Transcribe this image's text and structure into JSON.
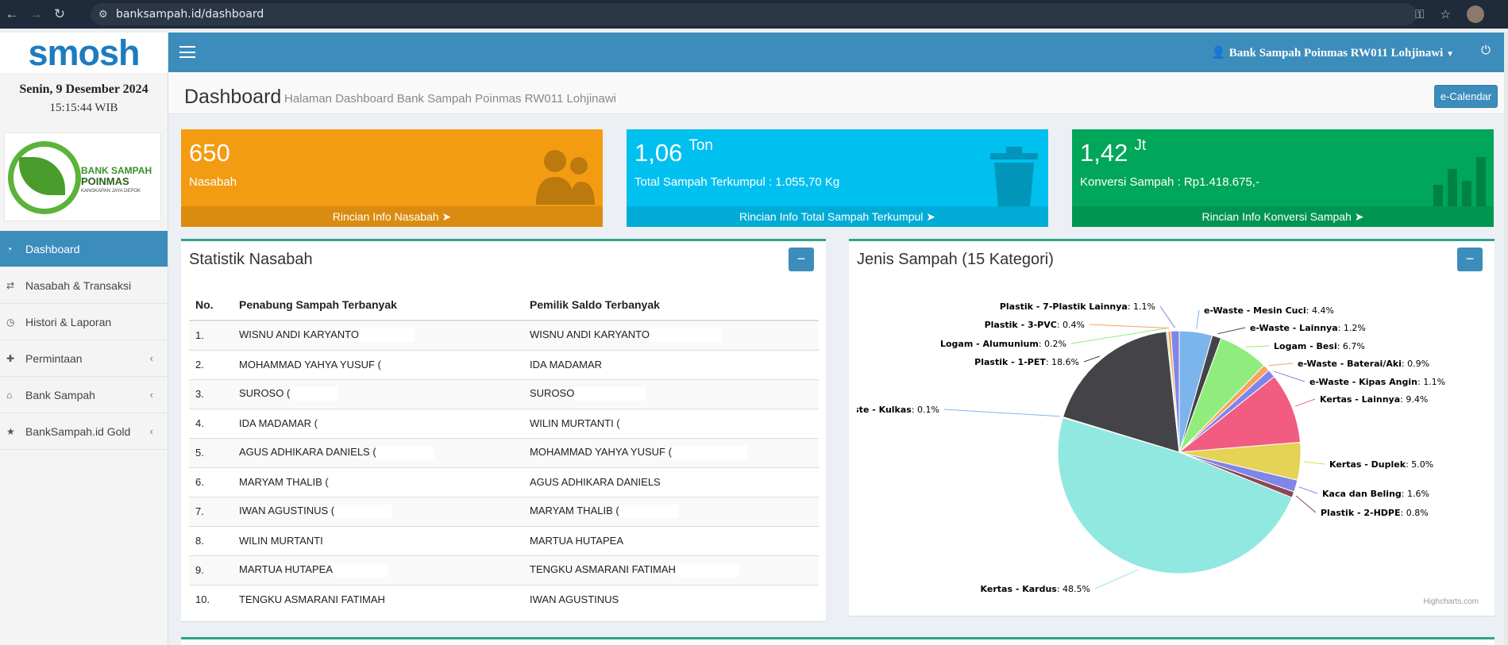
{
  "browser": {
    "url": "banksampah.id/dashboard"
  },
  "app": {
    "logo_text": "smosh",
    "date": "Senin, 9 Desember 2024",
    "time": "15:15:44 WIB"
  },
  "brand_logo": {
    "line1": "BANK SAMPAH",
    "line2": "POINMAS",
    "line3": "KANGKAPAN JAYA DEPOK"
  },
  "sidebar": {
    "items": [
      {
        "label": "Dashboard"
      },
      {
        "label": "Nasabah & Transaksi"
      },
      {
        "label": "Histori & Laporan"
      },
      {
        "label": "Permintaan"
      },
      {
        "label": "Bank Sampah"
      },
      {
        "label": "BankSampah.id Gold"
      }
    ]
  },
  "header": {
    "user": "Bank Sampah Poinmas RW011 Lohjinawi"
  },
  "page": {
    "title": "Dashboard",
    "subtitle": "Halaman Dashboard Bank Sampah Poinmas RW011 Lohjinawi",
    "ecal_label": "e-Calendar"
  },
  "cards": [
    {
      "value": "650",
      "unit": "",
      "label": "Nasabah",
      "link": "Rincian Info Nasabah",
      "color": "#f39c12",
      "foot_color": "#da8c10"
    },
    {
      "value": "1,06",
      "unit": "Ton",
      "label": "Total Sampah Terkumpul : 1.055,70 Kg",
      "link": "Rincian Info Total Sampah Terkumpul",
      "color": "#00c0ef",
      "foot_color": "#00acd6"
    },
    {
      "value": "1,42",
      "unit": "Jt",
      "label": "Konversi Sampah : Rp1.418.675,-",
      "link": "Rincian Info Konversi Sampah",
      "color": "#00a65a",
      "foot_color": "#009551"
    }
  ],
  "stat": {
    "title": "Statistik Nasabah",
    "headers": [
      "No.",
      "Penabung Sampah Terbanyak",
      "Pemilik Saldo Terbanyak"
    ],
    "rows": [
      {
        "no": "1.",
        "penabung": "WISNU ANDI KARYANTO",
        "pemilik": "WISNU ANDI KARYANTO"
      },
      {
        "no": "2.",
        "penabung": "MOHAMMAD YAHYA YUSUF (",
        "pemilik": "IDA MADAMAR"
      },
      {
        "no": "3.",
        "penabung": "SUROSO (",
        "pemilik": "SUROSO"
      },
      {
        "no": "4.",
        "penabung": "IDA MADAMAR (",
        "pemilik": "WILIN MURTANTI ("
      },
      {
        "no": "5.",
        "penabung": "AGUS ADHIKARA DANIELS (",
        "pemilik": "MOHAMMAD YAHYA YUSUF ("
      },
      {
        "no": "6.",
        "penabung": "MARYAM THALIB (",
        "pemilik": "AGUS ADHIKARA DANIELS"
      },
      {
        "no": "7.",
        "penabung": "IWAN AGUSTINUS (",
        "pemilik": "MARYAM THALIB ("
      },
      {
        "no": "8.",
        "penabung": "WILIN MURTANTI",
        "pemilik": "MARTUA HUTAPEA"
      },
      {
        "no": "9.",
        "penabung": "MARTUA HUTAPEA",
        "pemilik": "TENGKU ASMARANI FATIMAH"
      },
      {
        "no": "10.",
        "penabung": "TENGKU ASMARANI FATIMAH",
        "pemilik": "IWAN AGUSTINUS"
      }
    ]
  },
  "pie": {
    "title": "Jenis Sampah (15 Kategori)",
    "credit": "Highcharts.com"
  },
  "chart_data": {
    "type": "pie",
    "title": "Jenis Sampah (15 Kategori)",
    "slices": [
      {
        "name": "e-Waste - Mesin Cuci",
        "value": 4.4,
        "label": "4.4%",
        "color": "#7cb5ec"
      },
      {
        "name": "e-Waste - Lainnya",
        "value": 1.2,
        "label": "1.2%",
        "color": "#434348"
      },
      {
        "name": "Logam - Besi",
        "value": 6.7,
        "label": "6.7%",
        "color": "#90ed7d"
      },
      {
        "name": "e-Waste - Baterai/Aki",
        "value": 0.9,
        "label": "0.9%",
        "color": "#f7a35c"
      },
      {
        "name": "e-Waste - Kipas Angin",
        "value": 1.1,
        "label": "1.1%",
        "color": "#8085e9"
      },
      {
        "name": "Kertas - Lainnya",
        "value": 9.4,
        "label": "9.4%",
        "color": "#f15c80"
      },
      {
        "name": "Kertas - Duplek",
        "value": 5.0,
        "label": "5.0%",
        "color": "#e4d354"
      },
      {
        "name": "Kaca dan Beling",
        "value": 1.6,
        "label": "1.6%",
        "color": "#8085e8"
      },
      {
        "name": "Plastik - 2-HDPE",
        "value": 0.8,
        "label": "0.8%",
        "color": "#8d4653"
      },
      {
        "name": "Kertas - Kardus",
        "value": 48.5,
        "label": "48.5%",
        "color": "#91e8e1"
      },
      {
        "name": "e-Waste - Kulkas",
        "value": 0.1,
        "label": "0.1%",
        "color": "#7cb5ec"
      },
      {
        "name": "Plastik - 1-PET",
        "value": 18.6,
        "label": "18.6%",
        "color": "#434348"
      },
      {
        "name": "Logam - Alumunium",
        "value": 0.2,
        "label": "0.2%",
        "color": "#90ed7d"
      },
      {
        "name": "Plastik - 3-PVC",
        "value": 0.4,
        "label": "0.4%",
        "color": "#f7a35c"
      },
      {
        "name": "Plastik - 7-Plastik Lainnya",
        "value": 1.1,
        "label": "1.1%",
        "color": "#8085e9"
      }
    ]
  }
}
